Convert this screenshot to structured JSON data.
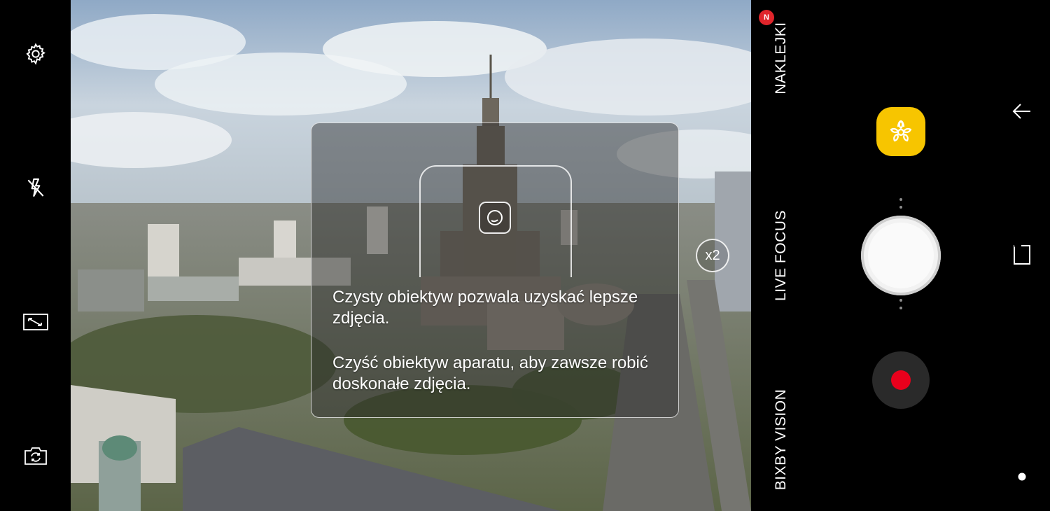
{
  "left_controls": {
    "settings_icon": "gear-icon",
    "flash_icon": "flash-off-icon",
    "ratio_icon": "aspect-ratio-icon",
    "switch_icon": "switch-camera-icon"
  },
  "tip": {
    "line1": "Czysty obiektyw pozwala uzyskać lepsze zdjęcia.",
    "line2": "Czyść obiektyw aparatu, aby zawsze robić doskonałe zdjęcia."
  },
  "zoom": {
    "label": "x2"
  },
  "modes": {
    "stickers": "NAKLEJKI",
    "stickers_badge": "N",
    "live_focus": "LIVE FOCUS",
    "bixby_vision": "BIXBY VISION"
  },
  "right_controls": {
    "bixby_icon": "bixby-flower-icon",
    "shutter_icon": "shutter-icon",
    "record_icon": "record-icon"
  },
  "nav": {
    "back_icon": "back-arrow-icon",
    "recent_icon": "recent-apps-icon",
    "home_icon": "home-dot-icon"
  },
  "colors": {
    "bixby_yellow": "#f7c500",
    "record_red": "#e8001c",
    "badge_red": "#e0252b"
  }
}
